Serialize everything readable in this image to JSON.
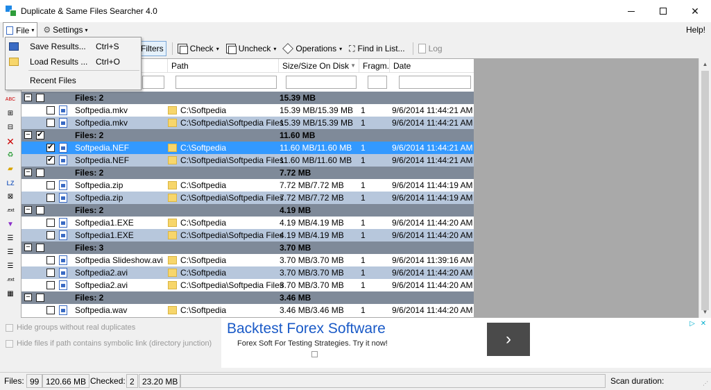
{
  "window": {
    "title": "Duplicate & Same Files Searcher 4.0",
    "minimize": "",
    "maximize": "",
    "close": "✕"
  },
  "menubar": {
    "file": "File",
    "settings": "Settings",
    "help": "Help!"
  },
  "file_menu": {
    "items": [
      {
        "label": "Save Results...",
        "shortcut": "Ctrl+S"
      },
      {
        "label": "Load Results ...",
        "shortcut": "Ctrl+O"
      },
      {
        "label": "Recent Files",
        "shortcut": ""
      }
    ]
  },
  "toolbar": {
    "filters": "Filters",
    "check": "Check",
    "uncheck": "Uncheck",
    "operations": "Operations",
    "find_in_list": "Find in List...",
    "log": "Log"
  },
  "columns": {
    "path": "Path",
    "size": "Size/Size On Disk",
    "fragm": "Fragm.",
    "date": "Date"
  },
  "groups": [
    {
      "label": "Files: 2",
      "size": "15.39 MB",
      "checked": false,
      "files": [
        {
          "name": "Softpedia.mkv",
          "path": "C:\\Softpedia",
          "size": "15.39 MB/15.39 MB",
          "fragm": "1",
          "date": "9/6/2014 11:44:21 AM",
          "checked": false,
          "style": "white"
        },
        {
          "name": "Softpedia.mkv",
          "path": "C:\\Softpedia\\Softpedia Files",
          "size": "15.39 MB/15.39 MB",
          "fragm": "1",
          "date": "9/6/2014 11:44:21 AM",
          "checked": false,
          "style": "alt"
        }
      ]
    },
    {
      "label": "Files: 2",
      "size": "11.60 MB",
      "checked": true,
      "files": [
        {
          "name": "Softpedia.NEF",
          "path": "C:\\Softpedia",
          "size": "11.60 MB/11.60 MB",
          "fragm": "1",
          "date": "9/6/2014 11:44:21 AM",
          "checked": true,
          "style": "sel"
        },
        {
          "name": "Softpedia.NEF",
          "path": "C:\\Softpedia\\Softpedia Files",
          "size": "11.60 MB/11.60 MB",
          "fragm": "1",
          "date": "9/6/2014 11:44:21 AM",
          "checked": true,
          "style": "alt"
        }
      ]
    },
    {
      "label": "Files: 2",
      "size": "7.72 MB",
      "checked": false,
      "files": [
        {
          "name": "Softpedia.zip",
          "path": "C:\\Softpedia",
          "size": "7.72 MB/7.72 MB",
          "fragm": "1",
          "date": "9/6/2014 11:44:19 AM",
          "checked": false,
          "style": "white"
        },
        {
          "name": "Softpedia.zip",
          "path": "C:\\Softpedia\\Softpedia Files",
          "size": "7.72 MB/7.72 MB",
          "fragm": "1",
          "date": "9/6/2014 11:44:19 AM",
          "checked": false,
          "style": "alt"
        }
      ]
    },
    {
      "label": "Files: 2",
      "size": "4.19 MB",
      "checked": false,
      "files": [
        {
          "name": "Softpedia1.EXE",
          "path": "C:\\Softpedia",
          "size": "4.19 MB/4.19 MB",
          "fragm": "1",
          "date": "9/6/2014 11:44:20 AM",
          "checked": false,
          "style": "white"
        },
        {
          "name": "Softpedia1.EXE",
          "path": "C:\\Softpedia\\Softpedia Files",
          "size": "4.19 MB/4.19 MB",
          "fragm": "1",
          "date": "9/6/2014 11:44:20 AM",
          "checked": false,
          "style": "alt"
        }
      ]
    },
    {
      "label": "Files: 3",
      "size": "3.70 MB",
      "checked": false,
      "files": [
        {
          "name": "Softpedia Slideshow.avi",
          "path": "C:\\Softpedia",
          "size": "3.70 MB/3.70 MB",
          "fragm": "1",
          "date": "9/6/2014 11:39:16 AM",
          "checked": false,
          "style": "white"
        },
        {
          "name": "Softpedia2.avi",
          "path": "C:\\Softpedia",
          "size": "3.70 MB/3.70 MB",
          "fragm": "1",
          "date": "9/6/2014 11:44:20 AM",
          "checked": false,
          "style": "alt"
        },
        {
          "name": "Softpedia2.avi",
          "path": "C:\\Softpedia\\Softpedia Files",
          "size": "3.70 MB/3.70 MB",
          "fragm": "1",
          "date": "9/6/2014 11:44:20 AM",
          "checked": false,
          "style": "white"
        }
      ]
    },
    {
      "label": "Files: 2",
      "size": "3.46 MB",
      "checked": false,
      "files": [
        {
          "name": "Softpedia.wav",
          "path": "C:\\Softpedia",
          "size": "3.46 MB/3.46 MB",
          "fragm": "1",
          "date": "9/6/2014 11:44:20 AM",
          "checked": false,
          "style": "white"
        }
      ]
    }
  ],
  "options": {
    "hide_groups": "Hide groups without real duplicates",
    "hide_symlink": "Hide files if path contains symbolic link (directory junction)"
  },
  "ad": {
    "title": "Backtest Forex Software",
    "subtitle": "Forex Soft For Testing Strategies. Try it now!",
    "arrow": "›"
  },
  "status": {
    "files_label": "Files:",
    "files_count": "99",
    "files_size": "120.66 MB",
    "checked_label": "Checked:",
    "checked_count": "2",
    "checked_size": "23.20 MB",
    "scan_duration_label": "Scan duration:"
  },
  "colors": {
    "group_row": "#7f8a99",
    "alt_row": "#b7c7dc",
    "selected_row": "#3399ff",
    "ad_title": "#1a5ac7"
  }
}
